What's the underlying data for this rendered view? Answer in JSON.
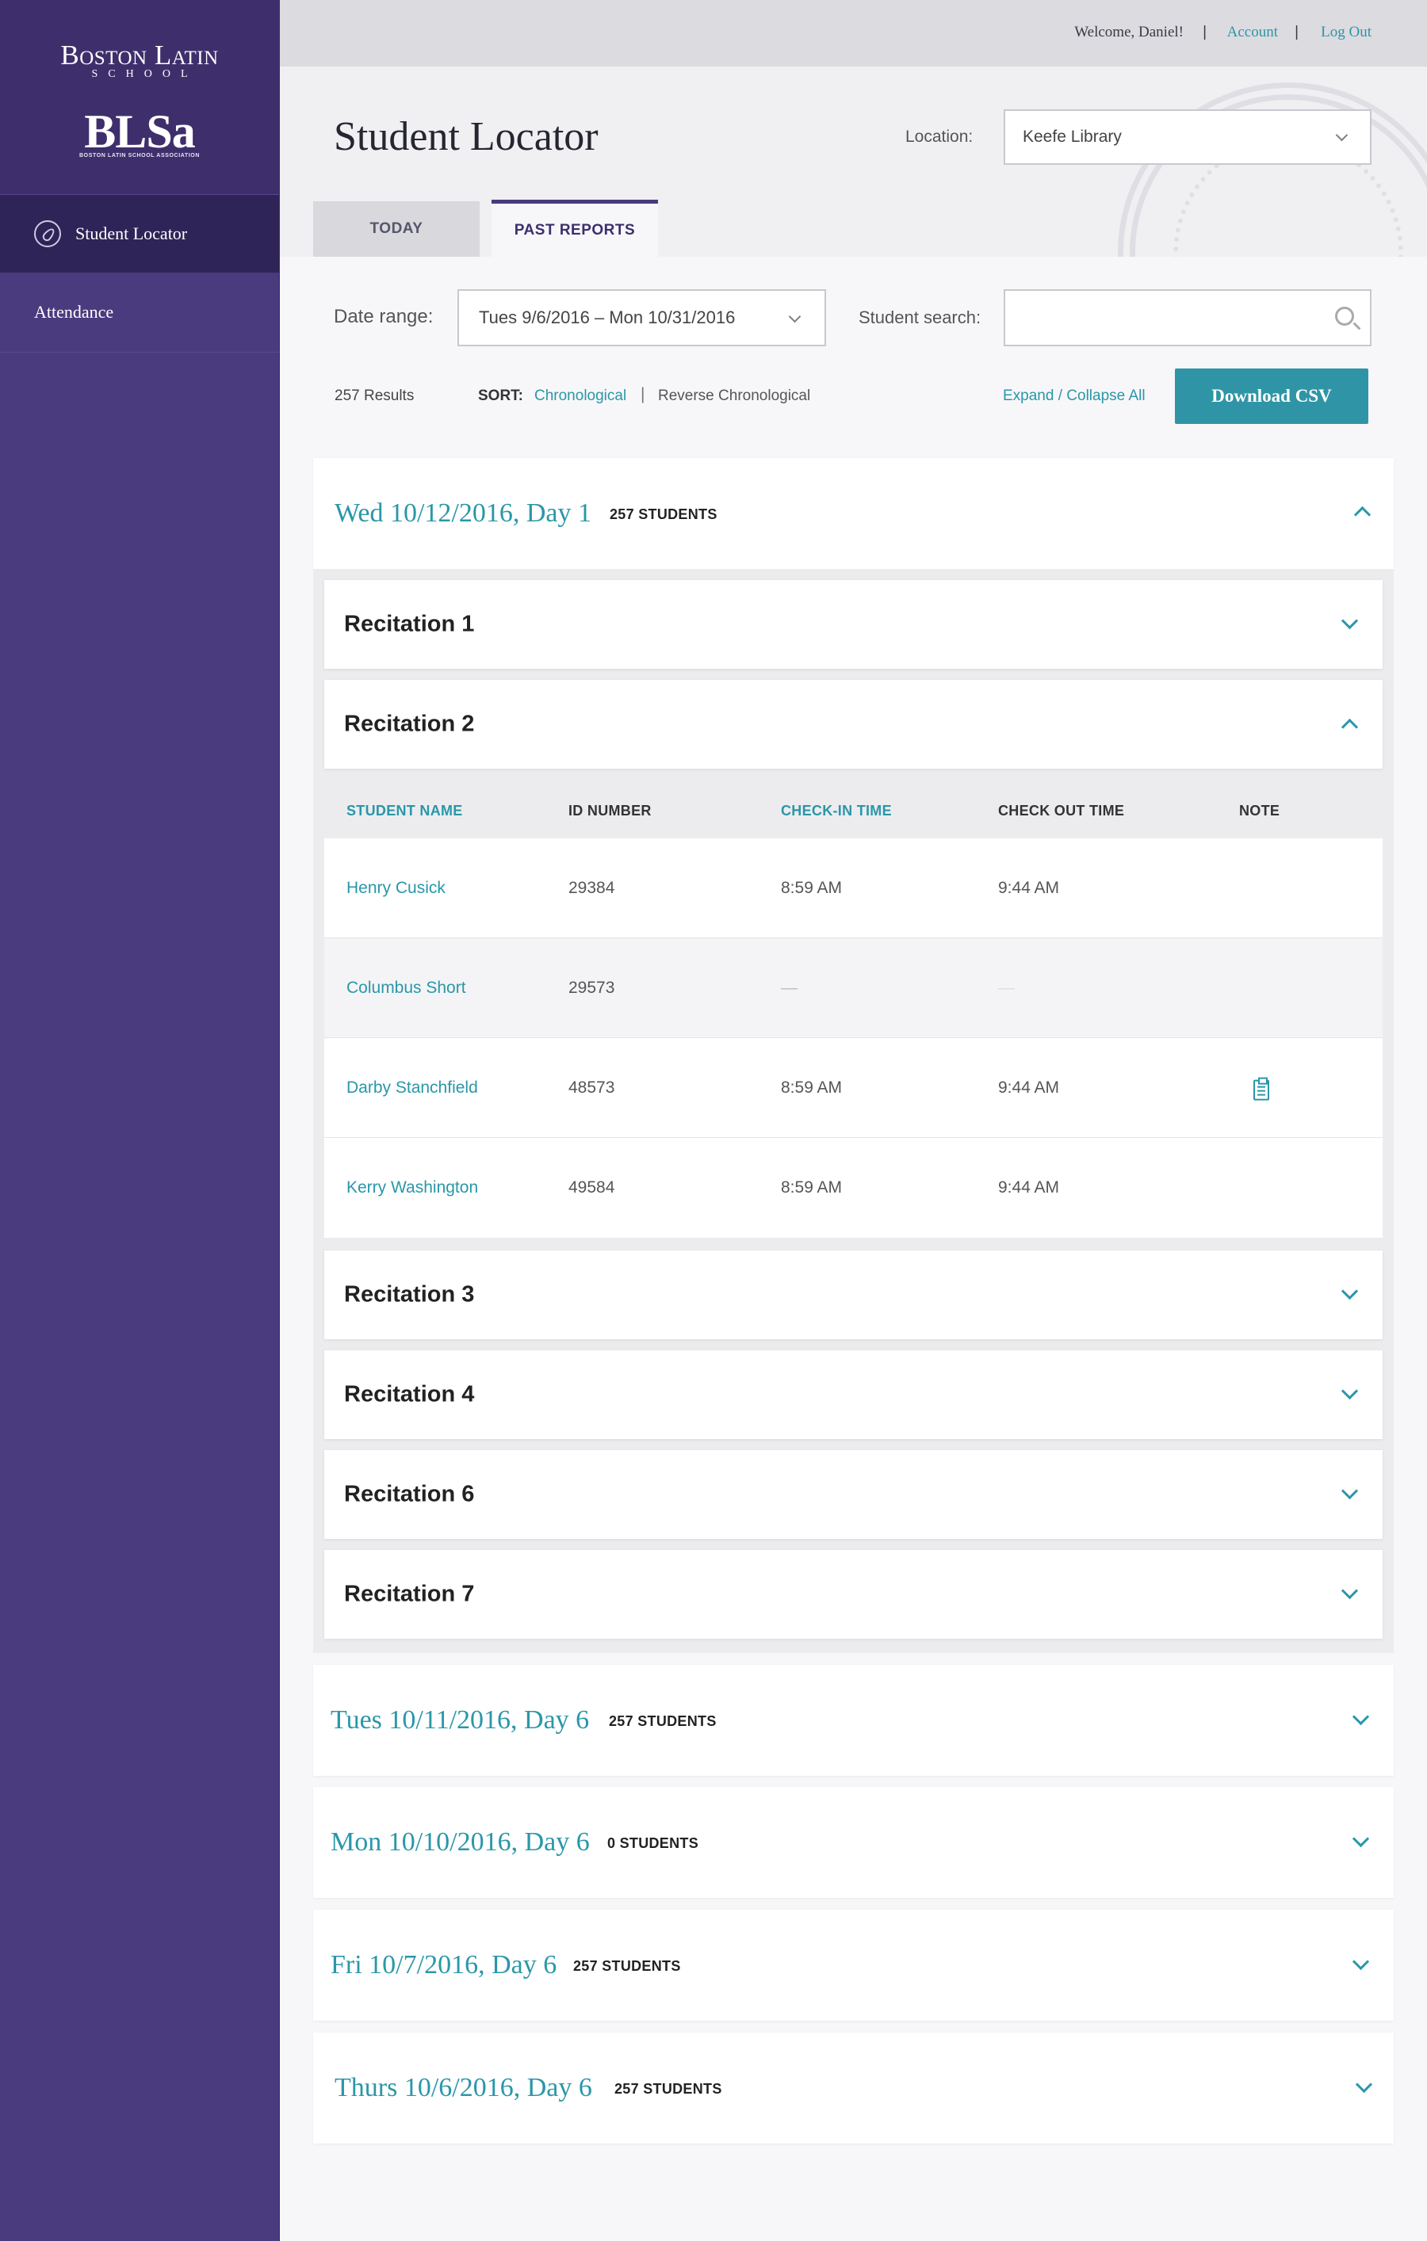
{
  "sidebar": {
    "brand_name": "Boston Latin",
    "brand_sub": "SCHOOL",
    "logo_text": "BLSa",
    "logo_sub": "BOSTON LATIN SCHOOL ASSOCIATION",
    "items": [
      {
        "label": "Student Locator",
        "icon": "compass-icon",
        "active": true
      },
      {
        "label": "Attendance",
        "active": false
      }
    ]
  },
  "topbar": {
    "welcome": "Welcome, Daniel!",
    "account": "Account",
    "logout": "Log Out"
  },
  "page": {
    "title": "Student Locator",
    "location_label": "Location:",
    "location_value": "Keefe Library"
  },
  "tabs": [
    {
      "label": "TODAY",
      "active": false
    },
    {
      "label": "PAST REPORTS",
      "active": true
    }
  ],
  "filters": {
    "date_range_label": "Date range:",
    "date_range_value": "Tues 9/6/2016 – Mon 10/31/2016",
    "student_search_label": "Student search:",
    "student_search_value": ""
  },
  "results_bar": {
    "results": "257 Results",
    "sort_label": "SORT:",
    "sort_options": [
      "Chronological",
      "Reverse Chronological"
    ],
    "sort_active": "Chronological",
    "expand_collapse": "Expand / Collapse All",
    "download": "Download CSV"
  },
  "days": [
    {
      "title": "Wed 10/12/2016, Day 1",
      "count": "257 STUDENTS",
      "expanded": true
    },
    {
      "title": "Tues 10/11/2016, Day 6",
      "count": "257 STUDENTS",
      "expanded": false
    },
    {
      "title": "Mon 10/10/2016, Day 6",
      "count": "0 STUDENTS",
      "expanded": false
    },
    {
      "title": "Fri 10/7/2016, Day 6",
      "count": "257 STUDENTS",
      "expanded": false
    },
    {
      "title": "Thurs 10/6/2016, Day 6",
      "count": "257 STUDENTS",
      "expanded": false
    }
  ],
  "recitations": [
    {
      "label": "Recitation 1",
      "expanded": false
    },
    {
      "label": "Recitation 2",
      "expanded": true
    },
    {
      "label": "Recitation 3",
      "expanded": false
    },
    {
      "label": "Recitation 4",
      "expanded": false
    },
    {
      "label": "Recitation 6",
      "expanded": false
    },
    {
      "label": "Recitation 7",
      "expanded": false
    }
  ],
  "table": {
    "headers": [
      "STUDENT NAME",
      "ID NUMBER",
      "CHECK-IN TIME",
      "CHECK OUT TIME",
      "NOTE"
    ],
    "rows": [
      {
        "name": "Henry Cusick",
        "id": "29384",
        "check_in": "8:59 AM",
        "check_out": "9:44 AM",
        "note": false
      },
      {
        "name": "Columbus Short",
        "id": "29573",
        "check_in": "—",
        "check_out": "—",
        "note": false
      },
      {
        "name": "Darby Stanchfield",
        "id": "48573",
        "check_in": "8:59 AM",
        "check_out": "9:44 AM",
        "note": true
      },
      {
        "name": "Kerry Washington",
        "id": "49584",
        "check_in": "8:59 AM",
        "check_out": "9:44 AM",
        "note": false
      }
    ]
  },
  "colors": {
    "sidebar": "#4a3a7e",
    "accent": "#2a97a8",
    "button": "#2f95a6"
  }
}
